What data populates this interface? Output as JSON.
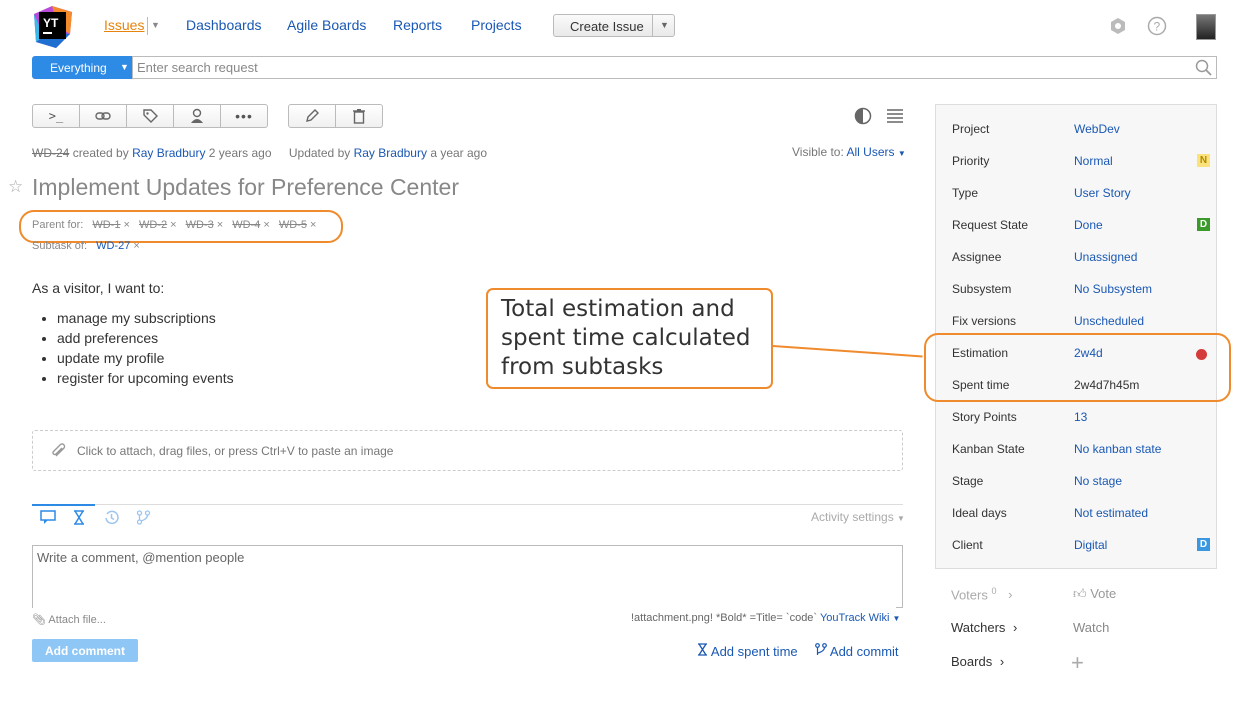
{
  "header": {
    "logo_text": "YT",
    "nav": [
      "Issues",
      "Dashboards",
      "Agile Boards",
      "Reports",
      "Projects"
    ],
    "create_issue": "Create Issue"
  },
  "search": {
    "context": "Everything",
    "placeholder": "Enter search request"
  },
  "issue": {
    "id": "WD-24",
    "created_by_prefix": "created by",
    "created_by": "Ray Bradbury",
    "created_ago": "2 years ago",
    "updated_prefix": "Updated by",
    "updated_by": "Ray Bradbury",
    "updated_ago": "a year ago",
    "visible_label": "Visible to:",
    "visible_value": "All Users",
    "title": "Implement Updates for Preference Center",
    "parent_label": "Parent for:",
    "parent_links": [
      "WD-1",
      "WD-2",
      "WD-3",
      "WD-4",
      "WD-5"
    ],
    "subtask_label": "Subtask of:",
    "subtask_link": "WD-27",
    "description_intro": "As a visitor, I want to:",
    "description_items": [
      "manage my subscriptions",
      "add preferences",
      "update my profile",
      "register for upcoming events"
    ],
    "attach_hint": "Click to attach, drag files, or press Ctrl+V to paste an image"
  },
  "activity": {
    "settings": "Activity settings",
    "comment_placeholder": "Write a comment, @mention people",
    "attach_file": "Attach file...",
    "wiki_hint": "!attachment.png! *Bold* =Title= `code`",
    "wiki_link": "YouTrack Wiki",
    "add_comment": "Add comment",
    "add_spent_time": "Add spent time",
    "add_commit": "Add commit"
  },
  "callout": {
    "lines": [
      "Total estimation and",
      "spent time calculated",
      "from subtasks"
    ]
  },
  "fields": [
    {
      "name": "Project",
      "value": "WebDev"
    },
    {
      "name": "Priority",
      "value": "Normal",
      "badge": "N",
      "badge_bg": "#fbe27c",
      "badge_fg": "#b08a00"
    },
    {
      "name": "Type",
      "value": "User Story"
    },
    {
      "name": "Request State",
      "value": "Done",
      "badge": "D",
      "badge_bg": "#3a9b2a",
      "badge_fg": "#ffffff"
    },
    {
      "name": "Assignee",
      "value": "Unassigned"
    },
    {
      "name": "Subsystem",
      "value": "No Subsystem"
    },
    {
      "name": "Fix versions",
      "value": "Unscheduled"
    },
    {
      "name": "Estimation",
      "value": "2w4d",
      "dot": "#d53b3b"
    },
    {
      "name": "Spent time",
      "value": "2w4d7h45m"
    },
    {
      "name": "Story Points",
      "value": "13"
    },
    {
      "name": "Kanban State",
      "value": "No kanban state"
    },
    {
      "name": "Stage",
      "value": "No stage"
    },
    {
      "name": "Ideal days",
      "value": "Not estimated"
    },
    {
      "name": "Client",
      "value": "Digital",
      "badge": "D",
      "badge_bg": "#3b98e0",
      "badge_fg": "#ffffff"
    }
  ],
  "voters": {
    "label": "Voters",
    "count": "0",
    "action": "Vote"
  },
  "watchers": {
    "label": "Watchers",
    "action": "Watch"
  },
  "boards": {
    "label": "Boards"
  }
}
